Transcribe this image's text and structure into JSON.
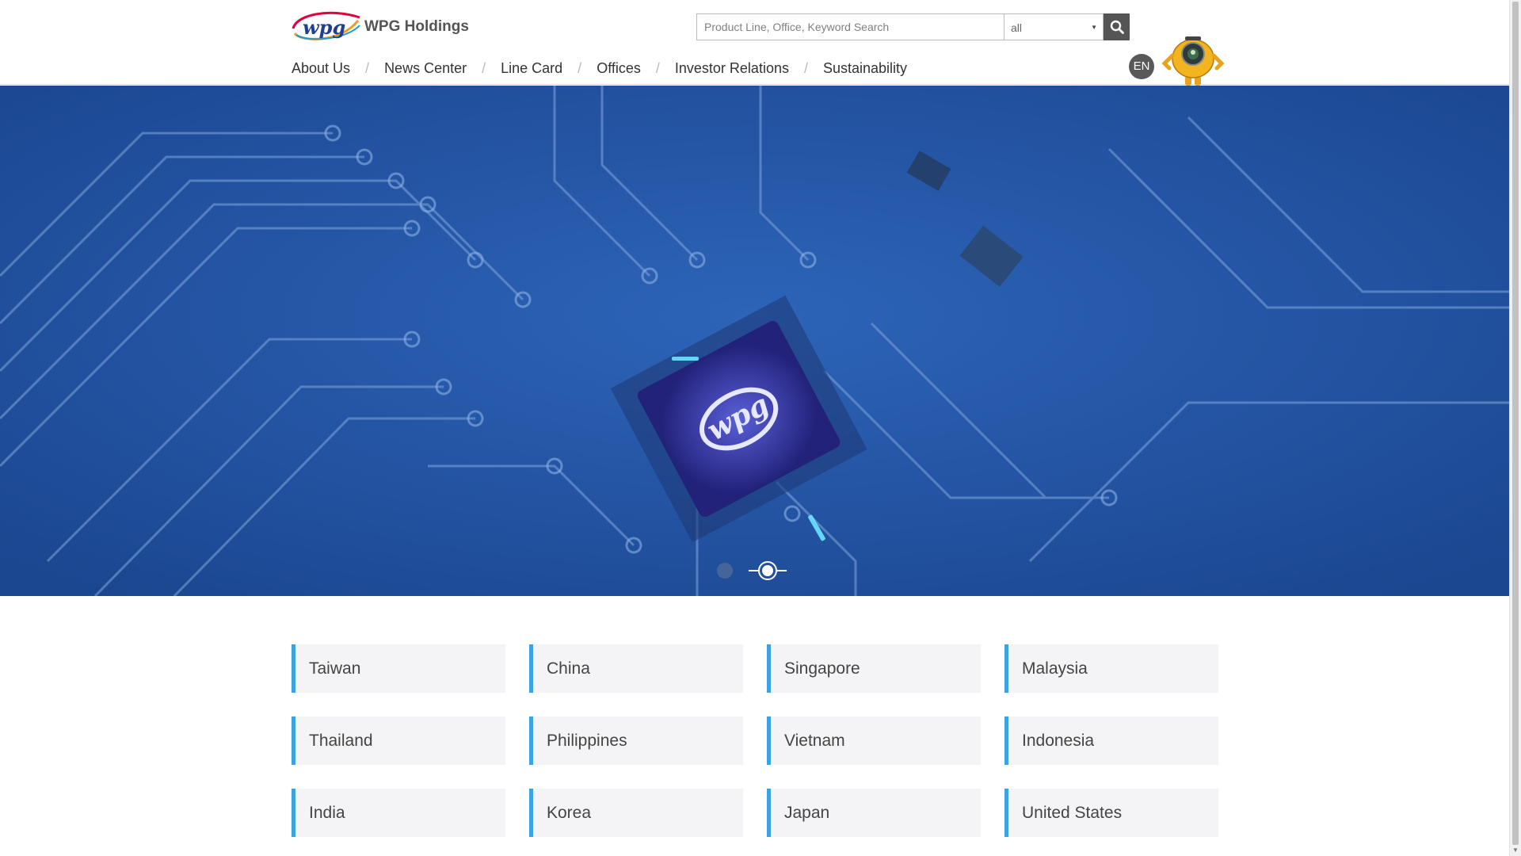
{
  "header": {
    "brand_name": "WPG Holdings",
    "logo_icon": "wpg-logo-icon",
    "search": {
      "placeholder": "Product Line, Office, Keyword Search",
      "scope_value": "all",
      "search_icon": "magnifier-icon"
    },
    "nav": [
      {
        "label": "About Us"
      },
      {
        "label": "News Center"
      },
      {
        "label": "Line Card"
      },
      {
        "label": "Offices"
      },
      {
        "label": "Investor Relations"
      },
      {
        "label": "Sustainability"
      }
    ],
    "nav_separator": "/",
    "language": "EN",
    "mascot_icon": "robot-mascot-icon"
  },
  "hero": {
    "chip_logo_text": "wpg",
    "slides": [
      {
        "active": false
      },
      {
        "active": true
      }
    ],
    "colors": {
      "background": "#1f4f9a",
      "accent_glow": "#6fe3ff"
    }
  },
  "countries": [
    {
      "label": "Taiwan"
    },
    {
      "label": "China"
    },
    {
      "label": "Singapore"
    },
    {
      "label": "Malaysia"
    },
    {
      "label": "Thailand"
    },
    {
      "label": "Philippines"
    },
    {
      "label": "Vietnam"
    },
    {
      "label": "Indonesia"
    },
    {
      "label": "India"
    },
    {
      "label": "Korea"
    },
    {
      "label": "Japan"
    },
    {
      "label": "United States"
    }
  ],
  "colors": {
    "card_accent": "#3aa3e3",
    "card_bg": "#f4f4f6"
  }
}
